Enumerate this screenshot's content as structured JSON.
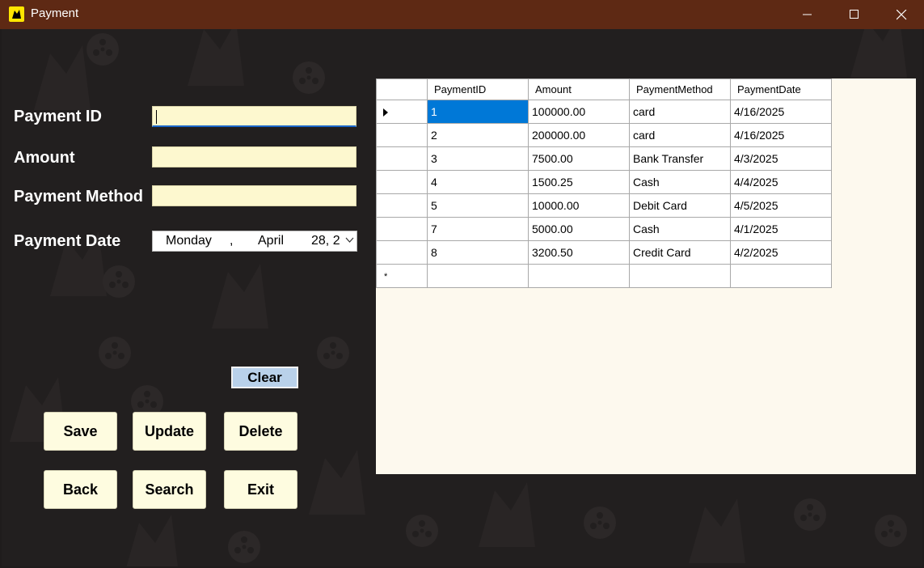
{
  "window": {
    "title": "Payment"
  },
  "form": {
    "payment_id_label": "Payment ID",
    "amount_label": "Amount",
    "method_label": "Payment Method",
    "date_label": "Payment Date",
    "payment_id_value": "",
    "amount_value": "",
    "method_value": "",
    "date": {
      "weekday": "Monday",
      "sep": ",",
      "month": "April",
      "day": "28, 2"
    }
  },
  "buttons": {
    "clear": "Clear",
    "save": "Save",
    "update": "Update",
    "delete": "Delete",
    "back": "Back",
    "search": "Search",
    "exit": "Exit"
  },
  "grid": {
    "columns": [
      "PaymentID",
      "Amount",
      "PaymentMethod",
      "PaymentDate"
    ],
    "rows": [
      [
        "1",
        "100000.00",
        "card",
        "4/16/2025"
      ],
      [
        "2",
        "200000.00",
        "card",
        "4/16/2025"
      ],
      [
        "3",
        "7500.00",
        "Bank Transfer",
        "4/3/2025"
      ],
      [
        "4",
        "1500.25",
        "Cash",
        "4/4/2025"
      ],
      [
        "5",
        "10000.00",
        "Debit Card",
        "4/5/2025"
      ],
      [
        "7",
        "5000.00",
        "Cash",
        "4/1/2025"
      ],
      [
        "8",
        "3200.50",
        "Credit Card",
        "4/2/2025"
      ]
    ],
    "new_row_marker": "*"
  },
  "colors": {
    "titlebar": "#5e2914",
    "background": "#221f1f",
    "input_bg": "#fdf8cf",
    "button_bg": "#fefce0",
    "clear_bg": "#b9d1ea",
    "selection": "#0078d7"
  }
}
